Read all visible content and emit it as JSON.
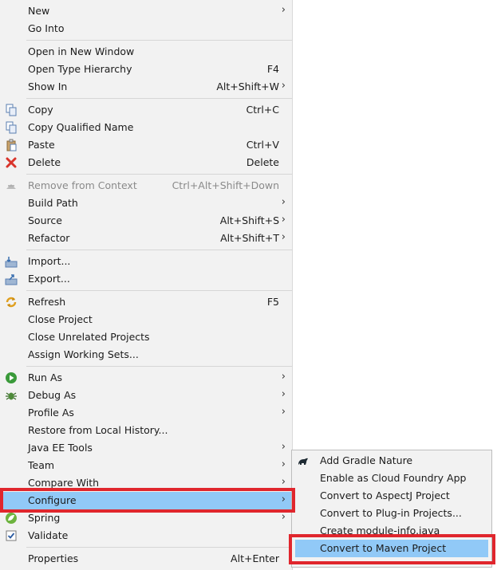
{
  "main_menu": {
    "new": {
      "label": "New"
    },
    "go_into": {
      "label": "Go Into"
    },
    "open_new_window": {
      "label": "Open in New Window"
    },
    "open_type_hierarchy": {
      "label": "Open Type Hierarchy",
      "shortcut": "F4"
    },
    "show_in": {
      "label": "Show In",
      "shortcut": "Alt+Shift+W"
    },
    "copy": {
      "label": "Copy",
      "shortcut": "Ctrl+C"
    },
    "copy_qualified": {
      "label": "Copy Qualified Name"
    },
    "paste": {
      "label": "Paste",
      "shortcut": "Ctrl+V"
    },
    "delete": {
      "label": "Delete",
      "shortcut": "Delete"
    },
    "remove_context": {
      "label": "Remove from Context",
      "shortcut": "Ctrl+Alt+Shift+Down"
    },
    "build_path": {
      "label": "Build Path"
    },
    "source": {
      "label": "Source",
      "shortcut": "Alt+Shift+S"
    },
    "refactor": {
      "label": "Refactor",
      "shortcut": "Alt+Shift+T"
    },
    "import": {
      "label": "Import..."
    },
    "export": {
      "label": "Export..."
    },
    "refresh": {
      "label": "Refresh",
      "shortcut": "F5"
    },
    "close_project": {
      "label": "Close Project"
    },
    "close_unrelated": {
      "label": "Close Unrelated Projects"
    },
    "assign_sets": {
      "label": "Assign Working Sets..."
    },
    "run_as": {
      "label": "Run As"
    },
    "debug_as": {
      "label": "Debug As"
    },
    "profile_as": {
      "label": "Profile As"
    },
    "restore_history": {
      "label": "Restore from Local History..."
    },
    "javaee_tools": {
      "label": "Java EE Tools"
    },
    "team": {
      "label": "Team"
    },
    "compare_with": {
      "label": "Compare With"
    },
    "configure": {
      "label": "Configure"
    },
    "spring": {
      "label": "Spring"
    },
    "validate": {
      "label": "Validate"
    },
    "properties": {
      "label": "Properties",
      "shortcut": "Alt+Enter"
    }
  },
  "submenu": {
    "add_gradle": {
      "label": "Add Gradle Nature"
    },
    "cloud_foundry": {
      "label": "Enable as Cloud Foundry App"
    },
    "aspectj": {
      "label": "Convert to AspectJ Project"
    },
    "plugin": {
      "label": "Convert to Plug-in Projects..."
    },
    "module_info": {
      "label": "Create module-info.java"
    },
    "maven": {
      "label": "Convert to Maven Project"
    }
  },
  "icons": {
    "copy": "copy-icon",
    "paste": "paste-icon",
    "delete": "delete-icon",
    "remove_context": "remove-context-icon",
    "import": "import-icon",
    "export": "export-icon",
    "refresh": "refresh-icon",
    "run_as": "run-icon",
    "debug_as": "debug-icon",
    "spring": "spring-icon",
    "validate": "checkbox-icon",
    "gradle": "gradle-icon",
    "submenu_arrow": "chevron-right-icon"
  },
  "colors": {
    "highlight": "#91c9f7",
    "annotation": "#e0262d",
    "menu_bg": "#f2f2f2"
  }
}
